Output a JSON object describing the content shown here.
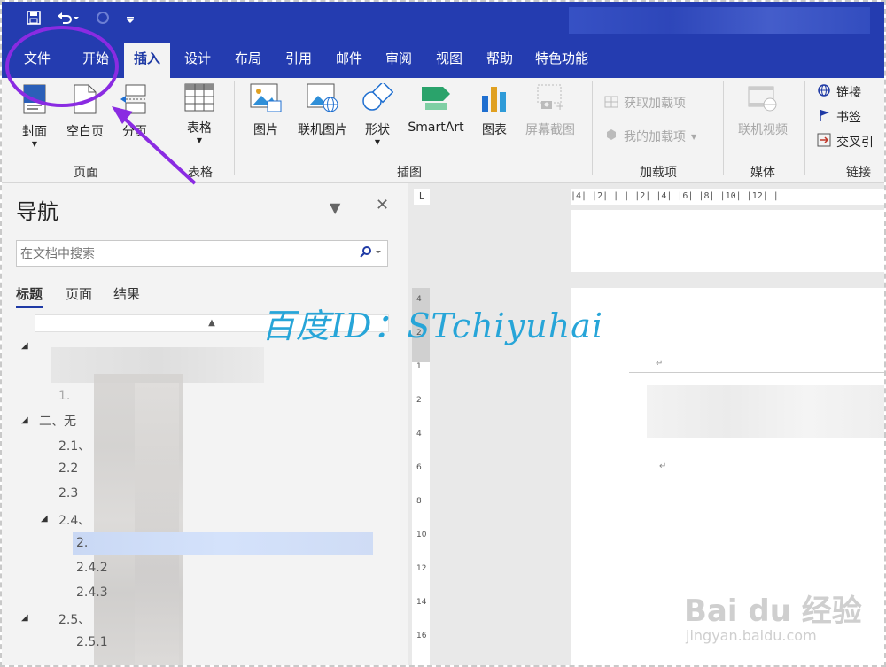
{
  "qat": {
    "save_icon": "save-icon",
    "undo_icon": "undo-icon",
    "redo_icon": "redo-icon"
  },
  "tabs": [
    {
      "label": "文件"
    },
    {
      "label": "开始"
    },
    {
      "label": "插入"
    },
    {
      "label": "设计"
    },
    {
      "label": "布局"
    },
    {
      "label": "引用"
    },
    {
      "label": "邮件"
    },
    {
      "label": "审阅"
    },
    {
      "label": "视图"
    },
    {
      "label": "帮助"
    },
    {
      "label": "特色功能"
    }
  ],
  "ribbon": {
    "pages": {
      "cover": "封面",
      "blank": "空白页",
      "break": "分页",
      "group": "页面"
    },
    "tables": {
      "table": "表格",
      "group": "表格"
    },
    "illustrations": {
      "picture": "图片",
      "online_picture": "联机图片",
      "shapes": "形状",
      "smartart": "SmartArt",
      "chart": "图表",
      "screenshot": "屏幕截图",
      "group": "插图"
    },
    "addins": {
      "get": "获取加载项",
      "my": "我的加载项",
      "group": "加载项"
    },
    "media": {
      "video": "联机视频",
      "group": "媒体"
    },
    "links": {
      "link": "链接",
      "bookmark": "书签",
      "crossref": "交叉引",
      "group": "链接"
    }
  },
  "nav": {
    "title": "导航",
    "search_placeholder": "在文档中搜索",
    "tabs": [
      "标题",
      "页面",
      "结果"
    ],
    "items": [
      "1.",
      "二、无",
      "2.1、",
      "2.2",
      "2.3",
      "2.4、",
      "2.",
      "2.4.2",
      "2.4.3",
      "2.5、",
      "2.5.1"
    ]
  },
  "ruler": {
    "h": "|4| |2| | | |2| |4| |6| |8| |10| |12| |",
    "v": [
      "4",
      "2",
      "1",
      "2",
      "4",
      "6",
      "8",
      "10",
      "12",
      "14",
      "16"
    ]
  },
  "watermark": "百度ID：STchiyuhai",
  "baidu": {
    "logo": "Bai du 经验",
    "url": "jingyan.baidu.com"
  },
  "colors": {
    "accent": "#243cb0",
    "annotation": "#8a2be2",
    "watermark": "#27a5d8"
  }
}
